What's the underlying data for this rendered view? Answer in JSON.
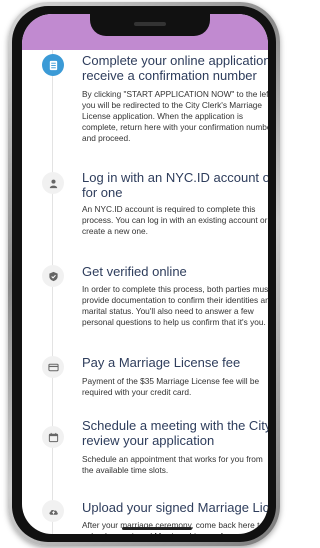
{
  "steps": [
    {
      "icon": "form-icon",
      "title_line1": "Complete your online application and",
      "title_line2": "receive a confirmation number",
      "text": "By clicking \"START APPLICATION NOW\" to the left, you will be redirected to the City Clerk's Marriage License application. When the application is complete, return here with your confirmation number and proceed."
    },
    {
      "icon": "person-icon",
      "title_line1": "Log in with an NYC.ID account or apply",
      "title_line2": "for one",
      "text": "An NYC.ID account is required to complete this process. You can log in with an existing account or create a new one."
    },
    {
      "icon": "shield-check-icon",
      "title_line1": "Get verified online",
      "title_line2": "",
      "text": "In order to complete this process, both parties must provide documentation to confirm their identities and marital status. You'll also need to answer a few personal questions to help us confirm that it's you."
    },
    {
      "icon": "credit-card-icon",
      "title_line1": "Pay a Marriage License fee",
      "title_line2": "",
      "text": "Payment of the $35 Marriage License fee will be required with your credit card."
    },
    {
      "icon": "calendar-icon",
      "title_line1": "Schedule a meeting with the City Clerk to",
      "title_line2": "review your application",
      "text": "Schedule an appointment that works for you from the available time slots."
    },
    {
      "icon": "cloud-upload-icon",
      "title_line1": "Upload your signed Marriage License",
      "title_line2": "",
      "text": "After your marriage ceremony, come back here to upload your signed Marriage License for your records and more."
    }
  ],
  "colors": {
    "header_bar": "#c18ad0",
    "active_marker": "#3b9ad6",
    "title": "#2e3d5c"
  }
}
